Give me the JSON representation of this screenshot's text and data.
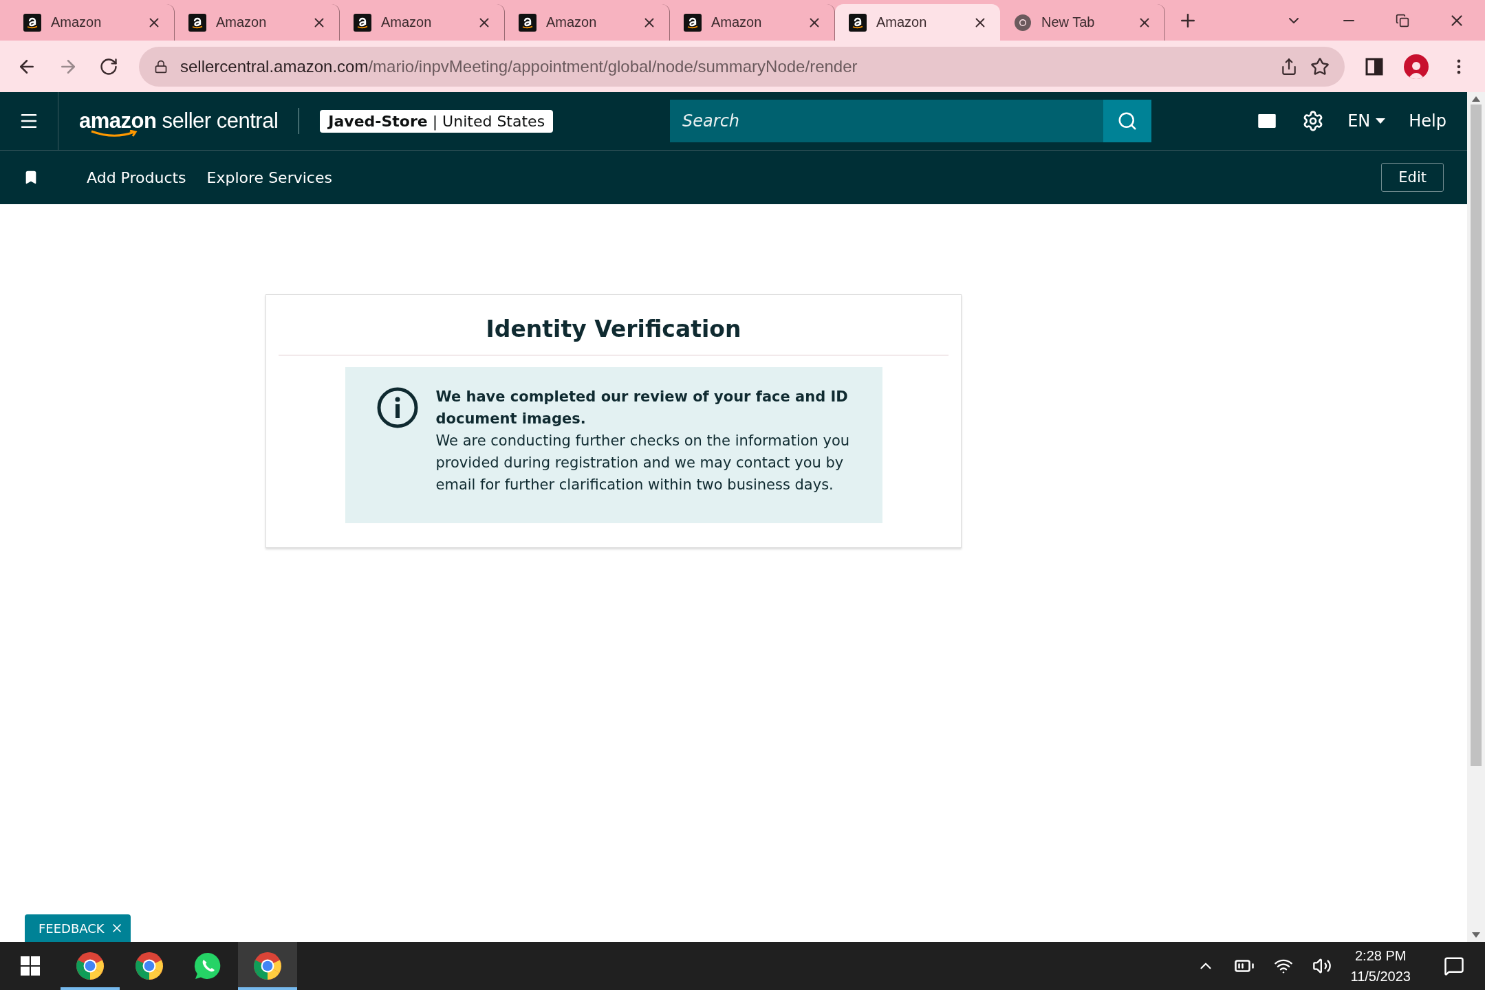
{
  "browser": {
    "tabs": [
      {
        "title": "Amazon",
        "kind": "amazon",
        "selected": false
      },
      {
        "title": "Amazon",
        "kind": "amazon",
        "selected": false
      },
      {
        "title": "Amazon",
        "kind": "amazon",
        "selected": false
      },
      {
        "title": "Amazon",
        "kind": "amazon",
        "selected": false
      },
      {
        "title": "Amazon",
        "kind": "amazon",
        "selected": false
      },
      {
        "title": "Amazon",
        "kind": "amazon",
        "selected": true
      },
      {
        "title": "New Tab",
        "kind": "chrome",
        "selected": false
      }
    ],
    "url": {
      "host": "sellercentral.amazon.com",
      "path": "/mario/inpvMeeting/appointment/global/node/summaryNode/render"
    }
  },
  "header": {
    "logo": {
      "brand": "amazon",
      "product": "seller central"
    },
    "store": "**Javed-Store** | United States",
    "search": {
      "placeholder": "Search"
    },
    "language": "EN",
    "help": "Help"
  },
  "subnav": {
    "items": [
      "Add Products",
      "Explore Services"
    ],
    "edit": "Edit"
  },
  "card": {
    "title": "Identity Verification",
    "alert": {
      "heading": "We have completed our review of your face and ID document images.",
      "body": "We are conducting further checks on the information you provided during registration and we may contact you by email for further clarification within two business days."
    }
  },
  "feedback": "FEEDBACK",
  "taskbar": {
    "apps": [
      {
        "kind": "chrome",
        "running": true,
        "selected": false
      },
      {
        "kind": "chrome",
        "running": false,
        "selected": false
      },
      {
        "kind": "whatsapp",
        "running": false,
        "selected": false
      },
      {
        "kind": "chrome",
        "running": true,
        "selected": true
      }
    ],
    "time": "2:28 PM",
    "date": "11/5/2023"
  }
}
